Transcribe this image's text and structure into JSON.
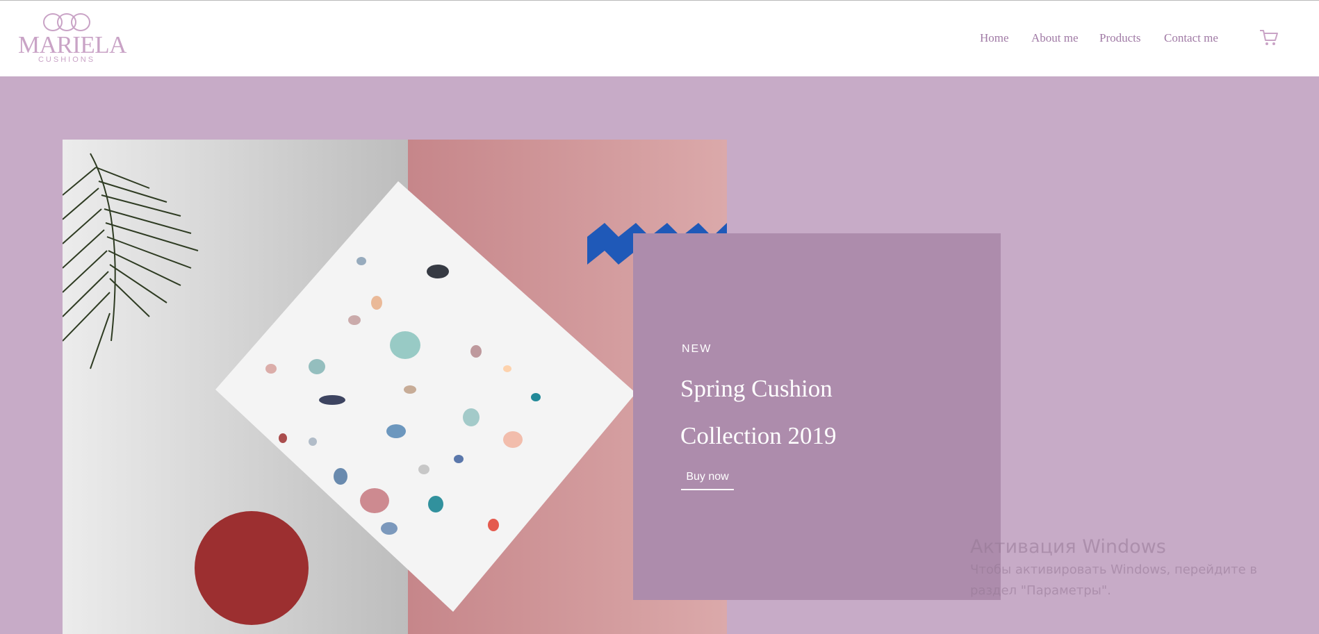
{
  "brand": {
    "name": "MARIELA",
    "sub": "CUSHIONS"
  },
  "nav": {
    "items": [
      {
        "label": "Home"
      },
      {
        "label": "About me"
      },
      {
        "label": "Products"
      },
      {
        "label": "Contact me"
      }
    ],
    "cart_icon": "shopping-cart-icon"
  },
  "hero": {
    "tag": "NEW",
    "title_line1": "Spring Cushion",
    "title_line2": "Collection 2019",
    "cta": "Buy now"
  },
  "windows_overlay": {
    "title": "Активация Windows",
    "line1": "Чтобы активировать Windows, перейдите в",
    "line2": "раздел \"Параметры\"."
  },
  "colors": {
    "background": "#c7abc7",
    "panel": "#ad8cac",
    "brand": "#c9a3c6",
    "nav_text": "#a07aa5"
  }
}
